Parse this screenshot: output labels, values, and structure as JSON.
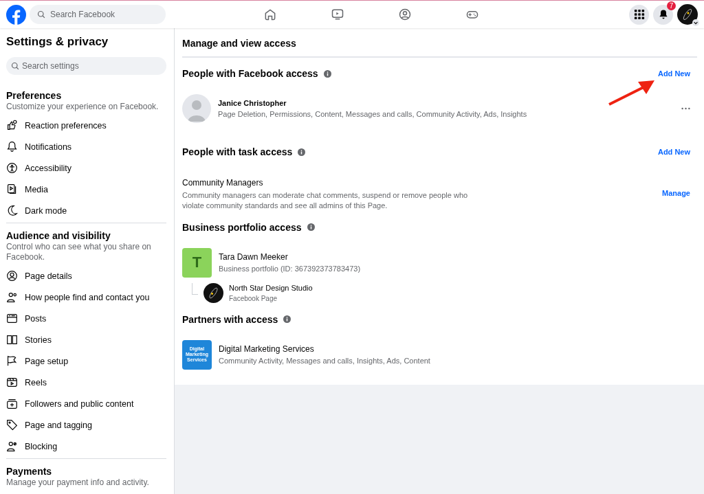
{
  "topbar": {
    "search": {
      "placeholder": "Search Facebook"
    },
    "nav": [
      {
        "selected": false
      },
      {
        "selected": false
      },
      {
        "selected": false
      },
      {
        "selected": false
      }
    ],
    "notification_count": "7"
  },
  "sidebar": {
    "title": "Settings & privacy",
    "search": {
      "placeholder": "Search settings"
    },
    "sections": [
      {
        "title": "Preferences",
        "description": "Customize your experience on Facebook.",
        "items": [
          "Reaction preferences",
          "Notifications",
          "Accessibility",
          "Media",
          "Dark mode"
        ]
      },
      {
        "title": "Audience and visibility",
        "description": "Control who can see what you share on Facebook.",
        "items": [
          "Page details",
          "How people find and contact you",
          "Posts",
          "Stories",
          "Page setup",
          "Reels",
          "Followers and public content",
          "Page and tagging",
          "Blocking"
        ]
      },
      {
        "title": "Payments",
        "description": "Manage your payment info and activity."
      }
    ]
  },
  "main": {
    "title": "Manage and view access",
    "facebook_access": {
      "title": "People with Facebook access",
      "action": "Add New",
      "people": [
        {
          "name": "Janice Christopher",
          "permissions": "Page Deletion, Permissions, Content, Messages and calls, Community Activity, Ads, Insights"
        }
      ]
    },
    "task_access": {
      "title": "People with task access",
      "action": "Add New",
      "roles": [
        {
          "name": "Community Managers",
          "description": "Community managers can moderate chat comments, suspend or remove people who violate community standards and see all admins of this Page.",
          "action": "Manage"
        }
      ]
    },
    "business_access": {
      "title": "Business portfolio access",
      "portfolio": {
        "initial": "T",
        "name": "Tara Dawn Meeker",
        "detail": "Business portfolio (ID: 367392373783473)"
      },
      "pages": [
        {
          "name": "North Star Design Studio",
          "detail": "Facebook Page"
        }
      ]
    },
    "partners": {
      "title": "Partners with access",
      "items": [
        {
          "logo_text": "Digital Marketing Services",
          "name": "Digital Marketing Services",
          "permissions": "Community Activity, Messages and calls, Insights, Ads, Content"
        }
      ]
    }
  }
}
